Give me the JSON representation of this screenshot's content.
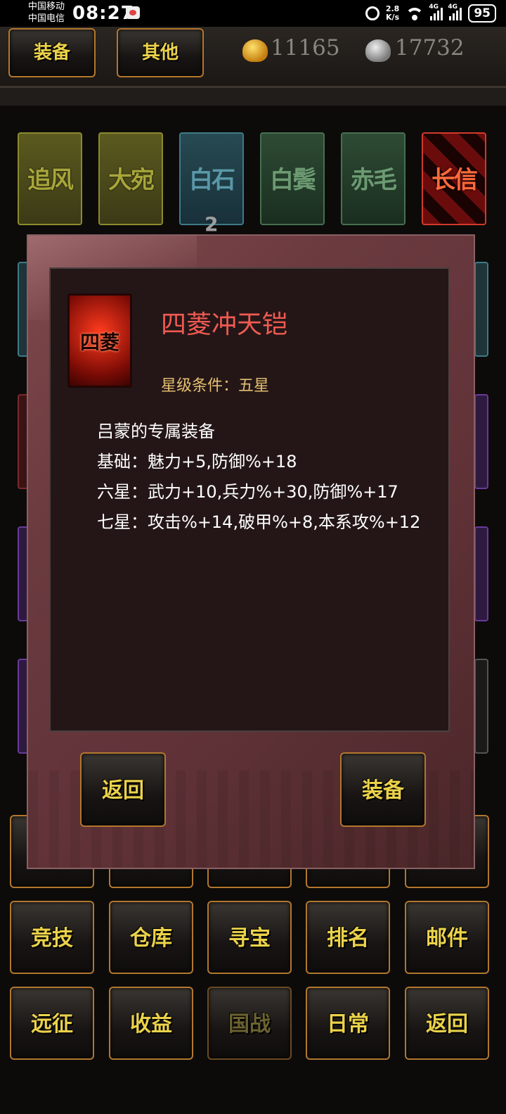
{
  "status_bar": {
    "carrier_1": "中国移动",
    "carrier_2": "中国电信",
    "time": "08:27",
    "net_speed_value": "2.8",
    "net_speed_unit": "K/s",
    "signal_1_label": "4G",
    "signal_2_label": "4G",
    "battery": "95"
  },
  "top_bar": {
    "tab_equipment": "装备",
    "tab_other": "其他",
    "gold": "11165",
    "silver": "17732"
  },
  "horses": [
    "追风",
    "大宛",
    "白石",
    "白鬓",
    "赤毛",
    "长信"
  ],
  "badge_count": "2",
  "modal": {
    "item_icon_text": "四菱",
    "item_name": "四菱冲天铠",
    "star_requirement": "星级条件：五星",
    "owner_line": "吕蒙的专属装备",
    "base_line": "基础：魅力+5,防御%+18",
    "six_star_line": "六星：武力+10,兵力%+30,防御%+17",
    "seven_star_line": "七星：攻击%+14,破甲%+8,本系攻%+12",
    "back_button": "返回",
    "equip_button": "装备"
  },
  "bottom_menu": {
    "row_1": [
      "竞技",
      "仓库",
      "寻宝",
      "排名",
      "邮件"
    ],
    "row_2": [
      "远征",
      "收益",
      "国战",
      "日常",
      "返回"
    ]
  },
  "colors": {
    "gold_text": "#ebd24a",
    "button_border": "#b3772d",
    "item_name": "#ef5a52",
    "star_req": "#e4c070"
  }
}
